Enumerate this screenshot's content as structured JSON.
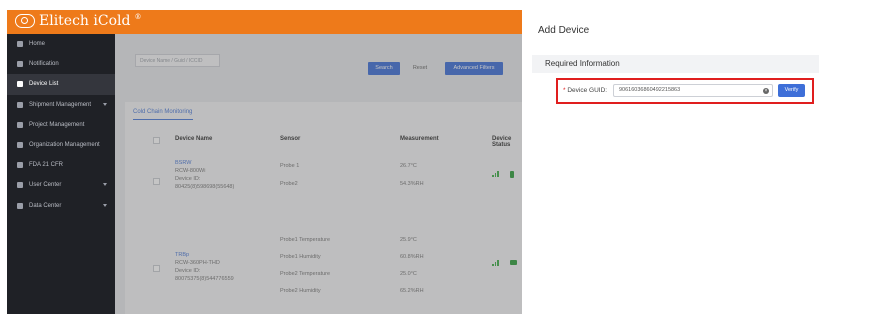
{
  "app": {
    "logo_text": "Elitech iCold",
    "logo_mark": "®"
  },
  "sidebar": {
    "items": [
      {
        "label": "Home",
        "icon": "home-icon",
        "active": false,
        "expandable": false
      },
      {
        "label": "Notification",
        "icon": "mail-icon",
        "active": false,
        "expandable": false
      },
      {
        "label": "Device List",
        "icon": "device-icon",
        "active": true,
        "expandable": false
      },
      {
        "label": "Shipment Management",
        "icon": "shipment-icon",
        "active": false,
        "expandable": true
      },
      {
        "label": "Project Management",
        "icon": "project-icon",
        "active": false,
        "expandable": false
      },
      {
        "label": "Organization Management",
        "icon": "organization-icon",
        "active": false,
        "expandable": false
      },
      {
        "label": "FDA 21 CFR",
        "icon": "shield-icon",
        "active": false,
        "expandable": false
      },
      {
        "label": "User Center",
        "icon": "user-icon",
        "active": false,
        "expandable": true
      },
      {
        "label": "Data Center",
        "icon": "data-icon",
        "active": false,
        "expandable": true
      }
    ]
  },
  "filter": {
    "search_placeholder": "Device Name / Guid / ICCID",
    "search_button": "Search",
    "reset_button": "Reset",
    "advanced_button": "Advanced Filters"
  },
  "device_table": {
    "tab": "Cold Chain Monitoring",
    "columns": [
      "Device Name",
      "Sensor",
      "Measurement",
      "Device Status"
    ],
    "rows": [
      {
        "name": "BSRW",
        "model": "RCW-800Wi",
        "id_label": "Device ID:",
        "id": "80425(8)598698(55648)",
        "sensors": [
          "Probe 1",
          "Probe2"
        ],
        "measurements": [
          "26.7°C",
          "54.3%RH"
        ]
      },
      {
        "name": "TRBp",
        "model": "RCW-360PH-THD",
        "id_label": "Device ID:",
        "id": "80075375(8)544776559",
        "sensors": [
          "Probe1 Temperature",
          "Probe1 Humidity",
          "Probe2 Temperature",
          "Probe2 Humidity"
        ],
        "measurements": [
          "25.9°C",
          "60.8%RH",
          "25.0°C",
          "65.2%RH"
        ]
      }
    ]
  },
  "add_device_panel": {
    "title": "Add Device",
    "section_title": "Required Information",
    "guid_label": "Device GUID:",
    "required_mark": "*",
    "guid_value": "90616036860492215863",
    "clear_symbol": "×",
    "verify_button": "Verify"
  },
  "colors": {
    "topbar": "#ee7a1a",
    "sidebar": "#1f2126",
    "primary_button": "#3e6fd8",
    "highlight": "#e01e1e",
    "status_green": "#2f9e3b"
  }
}
